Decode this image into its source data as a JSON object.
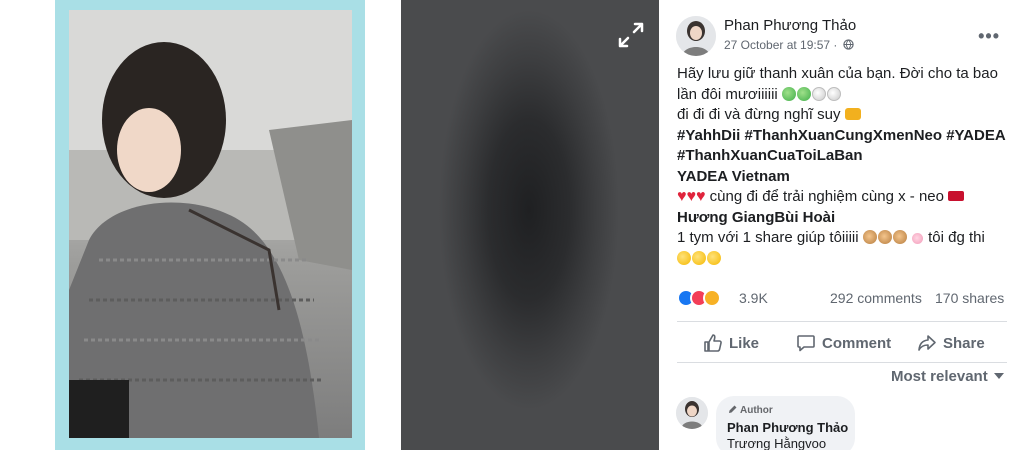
{
  "post": {
    "author": "Phan Phương Thảo",
    "time": "27 October at 19:57 ·",
    "more_icon": "more-options-icon",
    "text_lines": [
      "Hãy lưu giữ thanh xuân của bạn. Đời cho ta bao",
      "lần đôi mươiiiiii",
      "đi đi đi và đừng nghĩ suy",
      "#YahhDii #ThanhXuanCungXmenNeo #YADEA",
      "#ThanhXuanCuaToiLaBan",
      "YADEA Vietnam",
      "cùng đi để trải nghiệm cùng x - neo",
      "Hương GiangBùi Hoài",
      "1 tym với 1 share giúp tôiiiii",
      "tôi đg thi"
    ],
    "reactions_count": "3.9K",
    "comments_count": "292 comments",
    "shares_count": "170 shares"
  },
  "actions": {
    "like": "Like",
    "comment": "Comment",
    "share": "Share"
  },
  "comments": {
    "sort_label": "Most relevant",
    "first": {
      "badge": "Author",
      "author": "Phan Phương Thảo",
      "text": "Trương Hằngvoo"
    }
  },
  "colors": {
    "photo_frame": "#a9dfe6",
    "like_blue": "#1877f2",
    "love_red": "#f33e58",
    "sad_yellow": "#f7b125",
    "secondary_text": "#606770"
  }
}
